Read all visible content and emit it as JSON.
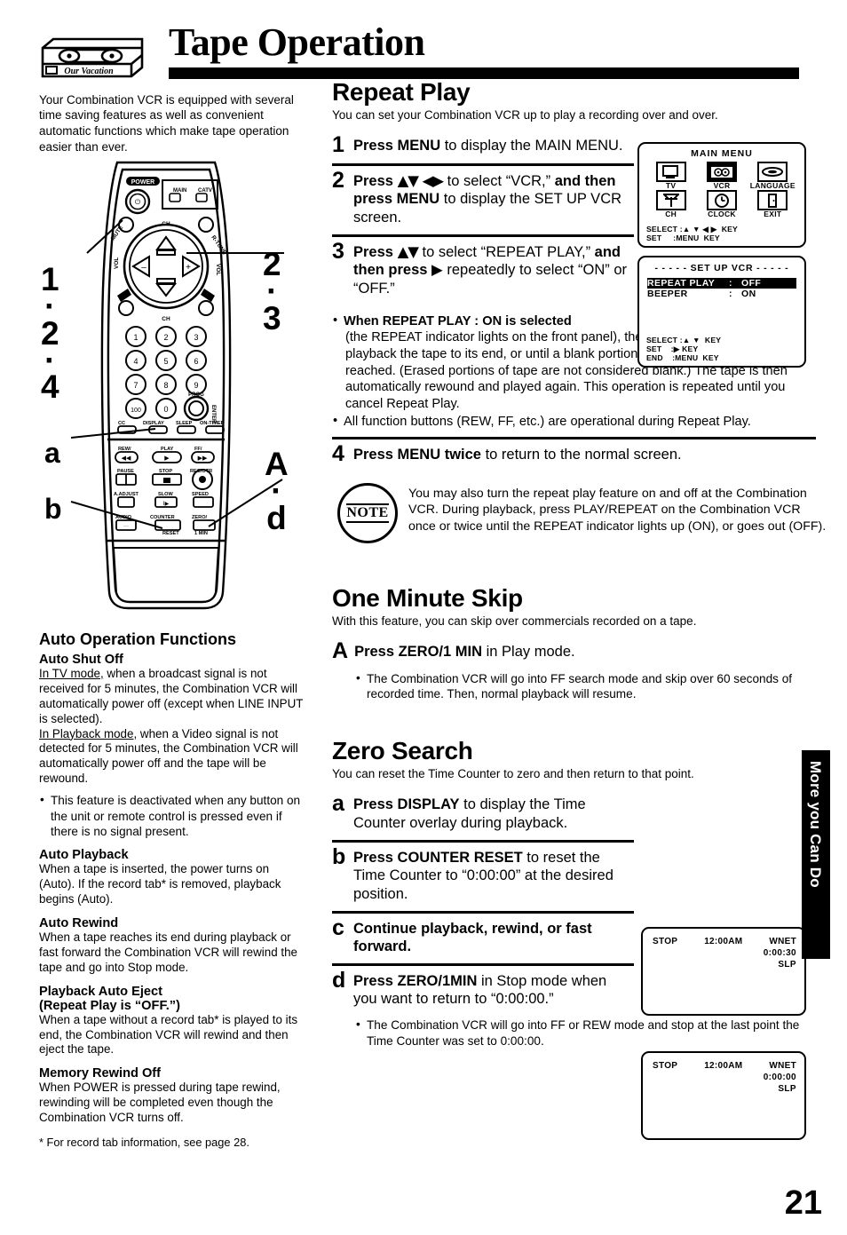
{
  "header": {
    "title": "Tape Operation",
    "cassette_label": "Our Vacation"
  },
  "intro": "Your Combination VCR is equipped with several time saving features as well as convenient automatic functions which make tape operation easier than ever.",
  "remote_callouts": {
    "menu_left": "1\n·\n2\n·\n4",
    "arrows_right": "2\n·\n3",
    "display_left": "a",
    "counter_reset_left": "b",
    "zero_right": "A\n·\nd",
    "l1": "1",
    "l2": "2",
    "l4": "4",
    "r2": "2",
    "r3": "3",
    "a": "a",
    "b": "b",
    "rA": "A",
    "rd": "d",
    "dot": "·",
    "button_labels": {
      "power": "POWER",
      "main": "MAIN",
      "catv": "CATV",
      "mute": "MUTE",
      "rtune": "R-TUNE",
      "vol_left": "VOL",
      "vol_right": "VOL",
      "ch_up": "CH",
      "ch_down": "CH",
      "keys": [
        "1",
        "2",
        "3",
        "4",
        "5",
        "6",
        "7",
        "8",
        "9",
        "100",
        "0"
      ],
      "prog": "PROG",
      "enter": "ENTER",
      "cc": "CC",
      "display": "DISPLAY",
      "sleep": "SLEEP",
      "on_timer": "ON-TIMER",
      "rew": "REW/",
      "play": "PLAY",
      "ff": "FF/",
      "pause": "PAUSE",
      "stop": "STOP",
      "rec_otr": "REC/OTR",
      "a_adjust": "A.ADJUST",
      "slow": "SLOW",
      "speed": "SPEED",
      "audio": "AUDIO",
      "counter": "COUNTER",
      "reset": "RESET",
      "zero": "ZERO/",
      "one_min": "1 MIN"
    }
  },
  "repeat_play": {
    "heading": "Repeat Play",
    "sub": "You can set your Combination VCR up to play a recording over and over.",
    "steps": [
      {
        "num": "1",
        "pre": "Press MENU",
        "rest": " to display the MAIN MENU."
      },
      {
        "num": "2",
        "pre": "Press",
        "arrows": "▲▼ ◀▶",
        "mid": " to select “VCR,”",
        "bold2": "and then press MENU",
        "rest": " to display the SET UP VCR screen."
      },
      {
        "num": "3",
        "pre": "Press",
        "arrows": "▲▼",
        "mid": " to select “REPEAT PLAY,”",
        "bold2": "and then press",
        "arrow2": "▶",
        "rest": "repeatedly to select “ON” or “OFF.”"
      },
      {
        "num": "4",
        "pre": "Press MENU twice",
        "rest": " to return to the normal screen."
      }
    ],
    "bullets": [
      {
        "bold": "When REPEAT PLAY : ON is selected",
        "text": "(the REPEAT indicator lights on the front panel), the Combination VCR will playback the tape to its end, or until a blank portion of 30 seconds or more is reached. (Erased portions of tape are not considered blank.) The tape is then automatically rewound and played again. This operation is repeated until you cancel Repeat Play."
      },
      {
        "bold": "",
        "text": "All function buttons (REW, FF, etc.) are operational during Repeat Play."
      }
    ],
    "note": "You may also turn the repeat play feature on and off at the Combination VCR. During playback, press PLAY/REPEAT on the Combination VCR once or twice until the REPEAT indicator lights up (ON), or goes out (OFF).",
    "note_badge": "NOTE"
  },
  "osd_main_menu": {
    "title": "MAIN MENU",
    "items": [
      {
        "label": "TV",
        "icon": "tv-icon",
        "selected": false
      },
      {
        "label": "VCR",
        "icon": "vcr-cassette-icon",
        "selected": true
      },
      {
        "label": "LANGUAGE",
        "icon": "language-icon",
        "selected": false
      },
      {
        "label": "CH",
        "icon": "antenna-icon",
        "selected": false
      },
      {
        "label": "CLOCK",
        "icon": "clock-icon",
        "selected": false
      },
      {
        "label": "EXIT",
        "icon": "exit-door-icon",
        "selected": false
      }
    ],
    "keys": "SELECT :▲ ▼ ◀ ▶  KEY\nSET     :MENU  KEY"
  },
  "osd_setup_vcr": {
    "title": "- - - - -  SET UP VCR  - - - - -",
    "rows": [
      {
        "name": "REPEAT PLAY",
        "colon": ":",
        "value": "OFF",
        "highlighted": true
      },
      {
        "name": "BEEPER",
        "colon": ":",
        "value": "ON",
        "highlighted": false
      }
    ],
    "keys": "SELECT :▲ ▼  KEY\nSET    :▶ KEY\nEND    :MENU  KEY"
  },
  "one_minute_skip": {
    "heading": "One Minute Skip",
    "sub": "With this feature, you can skip over commercials recorded on a tape.",
    "step": {
      "num": "A",
      "pre": "Press ZERO/1 MIN",
      "rest": " in Play mode."
    },
    "bullet": "The Combination VCR will go into FF search mode and skip over 60 seconds of recorded time. Then, normal playback will resume."
  },
  "zero_search": {
    "heading": "Zero Search",
    "sub": "You can reset the Time Counter to zero and then return to that point.",
    "steps": [
      {
        "num": "a",
        "pre": "Press DISPLAY",
        "rest": " to display the Time Counter overlay during playback."
      },
      {
        "num": "b",
        "pre": "Press COUNTER RESET",
        "rest": " to reset the Time Counter to “0:00:00” at the desired position."
      },
      {
        "num": "c",
        "pre": "Continue playback, rewind, or fast forward.",
        "rest": ""
      },
      {
        "num": "d",
        "pre": "Press ZERO/1MIN",
        "rest": " in Stop mode when you want to return to “0:00:00.”"
      }
    ],
    "bullet": "The Combination VCR will go into FF or REW mode and stop at the last point the Time Counter was set to 0:00:00."
  },
  "tv_screens": [
    {
      "mode": "STOP",
      "time": "12:00AM",
      "channel": "WNET",
      "counter": "0:00:30",
      "speed": "SLP"
    },
    {
      "mode": "STOP",
      "time": "12:00AM",
      "channel": "WNET",
      "counter": "0:00:00",
      "speed": "SLP"
    }
  ],
  "auto_operation": {
    "heading": "Auto Operation Functions",
    "sections": [
      {
        "title": "Auto Shut Off",
        "paras": [
          {
            "u": "In TV mode,",
            "t": " when a broadcast signal is not received for 5 minutes, the Combination VCR will automatically power off (except when LINE INPUT is selected)."
          },
          {
            "u": "In Playback mode",
            "t": ", when a Video signal is not detected for 5 minutes, the Combination VCR will automatically power off and the tape will be rewound."
          }
        ],
        "bullet": "This feature is deactivated when any button on the unit or remote control is pressed even if there is no signal present."
      },
      {
        "title": "Auto Playback",
        "paras": [
          {
            "u": "",
            "t": "When a tape is inserted, the power turns on (Auto). If the record tab* is removed, playback begins (Auto)."
          }
        ],
        "bullet": ""
      },
      {
        "title": "Auto Rewind",
        "paras": [
          {
            "u": "",
            "t": "When a tape reaches its end during playback or fast forward the Combination VCR will rewind the tape and go into Stop mode."
          }
        ],
        "bullet": ""
      },
      {
        "title": "Playback Auto Eject",
        "subtitle": "(Repeat Play is “OFF.”)",
        "paras": [
          {
            "u": "",
            "t": "When a tape without a record tab* is played to its end, the Combination VCR will rewind and then eject the tape."
          }
        ],
        "bullet": ""
      },
      {
        "title": "Memory Rewind Off",
        "paras": [
          {
            "u": "",
            "t": "When POWER is pressed during tape rewind, rewinding will be completed even though the Combination VCR turns off."
          }
        ],
        "bullet": ""
      }
    ],
    "footnote": "* For record tab information, see page 28."
  },
  "side_tab": "More you Can Do",
  "page_number": "21"
}
